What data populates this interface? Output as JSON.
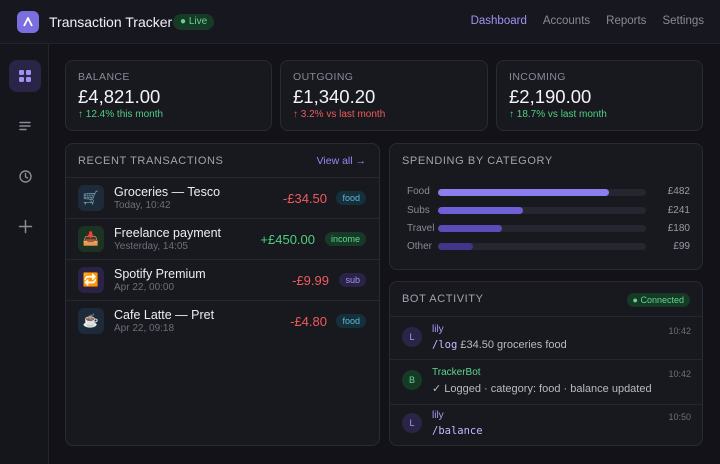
{
  "app": {
    "title": "Transaction Tracker",
    "status_badge": "● Live"
  },
  "nav": {
    "items": [
      "Dashboard",
      "Accounts",
      "Reports",
      "Settings"
    ],
    "active": "Dashboard"
  },
  "sidebar": {
    "items": [
      {
        "icon": "grid-icon",
        "active": true
      },
      {
        "icon": "list-icon",
        "active": false
      },
      {
        "icon": "clock-icon",
        "active": false
      },
      {
        "icon": "plus-icon",
        "active": false
      }
    ]
  },
  "stats": [
    {
      "label": "Balance",
      "value": "£4,821.00",
      "change": "↑ 12.4% this month",
      "trend": "up"
    },
    {
      "label": "Outgoing",
      "value": "£1,340.20",
      "change": "↑ 3.2% vs last month",
      "trend": "down"
    },
    {
      "label": "Incoming",
      "value": "£2,190.00",
      "change": "↑ 18.7% vs last month",
      "trend": "up"
    }
  ],
  "recent": {
    "title": "Recent Transactions",
    "view_all": "View all →",
    "rows": [
      {
        "icon": "cart-icon",
        "name": "Groceries — Tesco",
        "date": "Today, 10:42",
        "amount": "-£34.50",
        "tag": "food"
      },
      {
        "icon": "inbox-icon",
        "name": "Freelance payment",
        "date": "Yesterday, 14:05",
        "amount": "+£450.00",
        "tag": "income"
      },
      {
        "icon": "repeat-icon",
        "name": "Spotify Premium",
        "date": "Apr 22, 00:00",
        "amount": "-£9.99",
        "tag": "sub"
      },
      {
        "icon": "coffee-icon",
        "name": "Cafe Latte — Pret",
        "date": "Apr 22, 09:18",
        "amount": "-£4.80",
        "tag": "food"
      }
    ]
  },
  "spending": {
    "title": "Spending by Category",
    "categories": [
      {
        "label": "Food",
        "value": "£482",
        "fraction": 0.82,
        "color": "#8b7ff0"
      },
      {
        "label": "Subs",
        "value": "£241",
        "fraction": 0.41,
        "color": "#6e60d6"
      },
      {
        "label": "Travel",
        "value": "£180",
        "fraction": 0.31,
        "color": "#5a4db8"
      },
      {
        "label": "Other",
        "value": "£99",
        "fraction": 0.17,
        "color": "#3f3688"
      }
    ]
  },
  "bot": {
    "title": "Bot Activity",
    "status": "● Connected",
    "messages": [
      {
        "avatar": "L",
        "name": "lily",
        "command": "/log",
        "text": " £34.50 groceries food",
        "time": "10:42",
        "bot": false
      },
      {
        "avatar": "B",
        "name": "TrackerBot",
        "command": "",
        "text": "✓ Logged · category: food · balance updated",
        "time": "10:42",
        "bot": true
      },
      {
        "avatar": "L",
        "name": "lily",
        "command": "/balance",
        "text": "",
        "time": "10:50",
        "bot": false
      }
    ]
  }
}
